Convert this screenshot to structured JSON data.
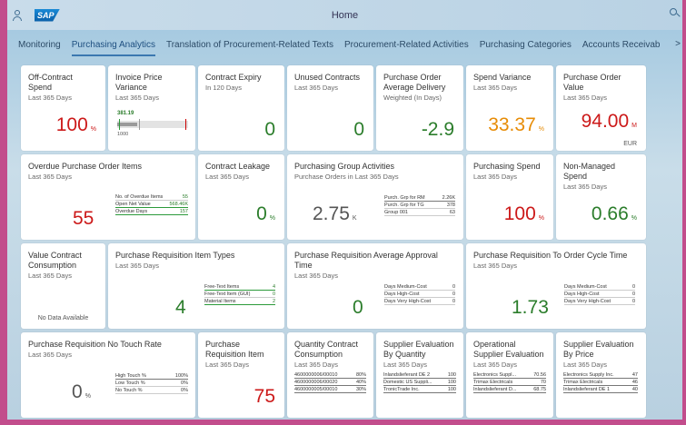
{
  "shell": {
    "title": "Home"
  },
  "tabs": [
    {
      "label": "Monitoring"
    },
    {
      "label": "Purchasing Analytics"
    },
    {
      "label": "Translation of Procurement-Related Texts"
    },
    {
      "label": "Procurement-Related Activities"
    },
    {
      "label": "Purchasing Categories"
    },
    {
      "label": "Accounts Receivab"
    }
  ],
  "tab_more": ">",
  "colors": {
    "negative": "#cc1919",
    "positive": "#2b7d2b",
    "critical": "#e78c07",
    "accent": "#3b78b0"
  },
  "tiles": {
    "offContract": {
      "title": "Off-Contract Spend",
      "sub": "Last 365 Days",
      "value": "100",
      "unit": "%"
    },
    "invoiceVariance": {
      "title": "Invoice Price Variance",
      "sub": "Last 365 Days",
      "value": "381.19",
      "min": "1000",
      "level": 0.28
    },
    "contractExpiry": {
      "title": "Contract Expiry",
      "sub": "In 120 Days",
      "value": "0"
    },
    "unusedContracts": {
      "title": "Unused Contracts",
      "sub": "Last 365 Days",
      "value": "0"
    },
    "poDelivery": {
      "title": "Purchase Order Average Delivery",
      "sub": "Weighted (In Days)",
      "value": "-2.9"
    },
    "spendVariance": {
      "title": "Spend Variance",
      "sub": "Last 365 Days",
      "value": "33.37",
      "unit": "%"
    },
    "poValue": {
      "title": "Purchase Order Value",
      "sub": "Last 365 Days",
      "value": "94.00",
      "unit": "M",
      "currency": "EUR"
    },
    "overduePO": {
      "title": "Overdue Purchase Order Items",
      "sub": "Last 365 Days",
      "value": "55",
      "rows": [
        {
          "label": "No. of Overdue Items",
          "value": "55"
        },
        {
          "label": "Open Net Value",
          "value": "568.46K"
        },
        {
          "label": "Overdue Days",
          "value": "157"
        }
      ]
    },
    "contractLeakage": {
      "title": "Contract Leakage",
      "sub": "Last 365 Days",
      "value": "0",
      "unit": "%"
    },
    "purchGroupActivities": {
      "title": "Purchasing Group Activities",
      "sub": "Purchase Orders in Last 365 Days",
      "value": "2.75",
      "unit": "K",
      "rows": [
        {
          "label": "Purch. Grp for RM",
          "value": "2.26K"
        },
        {
          "label": "Purch. Grp for TG",
          "value": "378"
        },
        {
          "label": "Group 001",
          "value": "63"
        }
      ]
    },
    "purchSpend": {
      "title": "Purchasing Spend",
      "sub": "Last 365 Days",
      "value": "100",
      "unit": "%"
    },
    "nonManaged": {
      "title": "Non-Managed Spend",
      "sub": "Last 365 Days",
      "value": "0.66",
      "unit": "%"
    },
    "valueContract": {
      "title": "Value Contract Consumption",
      "sub": "Last 365 Days",
      "nodata": "No Data Available"
    },
    "prItemTypes": {
      "title": "Purchase Requisition Item Types",
      "sub": "Last 365 Days",
      "value": "4",
      "rows": [
        {
          "label": "Free-Text Items",
          "value": "4"
        },
        {
          "label": "Free-Text Item (GUI)",
          "value": "0"
        },
        {
          "label": "Material Items",
          "value": "2"
        }
      ]
    },
    "prApproval": {
      "title": "Purchase Requisition Average Approval Time",
      "sub": "Last 365 Days",
      "value": "0",
      "rows": [
        {
          "label": "Days Medium-Cost",
          "value": "0"
        },
        {
          "label": "Days High-Cost",
          "value": "0"
        },
        {
          "label": "Days Very High-Cost",
          "value": "0"
        }
      ]
    },
    "prCycle": {
      "title": "Purchase Requisition To Order Cycle Time",
      "sub": "Last 365 Days",
      "value": "1.73",
      "rows": [
        {
          "label": "Days Medium-Cost",
          "value": "0"
        },
        {
          "label": "Days High-Cost",
          "value": "0"
        },
        {
          "label": "Days Very High-Cost",
          "value": "0"
        }
      ]
    },
    "prNoTouch": {
      "title": "Purchase Requisition No Touch Rate",
      "sub": "Last 365 Days",
      "value": "0",
      "unit": "%",
      "rows": [
        {
          "label": "High Touch %",
          "value": "100%"
        },
        {
          "label": "Low Touch %",
          "value": "0%"
        },
        {
          "label": "No Touch %",
          "value": "0%"
        }
      ]
    },
    "prItem": {
      "title": "Purchase Requisition Item",
      "sub": "Last 365 Days",
      "value": "75"
    },
    "qtyContract": {
      "title": "Quantity Contract Consumption",
      "sub": "Last 365 Days",
      "rows": [
        {
          "label": "4600000006/00010",
          "value": "80%"
        },
        {
          "label": "4600000006/00020",
          "value": "40%"
        },
        {
          "label": "4600000005/00010",
          "value": "30%"
        }
      ]
    },
    "supplierQty": {
      "title": "Supplier Evaluation By Quantity",
      "sub": "Last 365 Days",
      "rows": [
        {
          "label": "Inlandslieferant DE 2",
          "value": "100"
        },
        {
          "label": "Domestic US Suppli...",
          "value": "100"
        },
        {
          "label": "TronicTrade Inc.",
          "value": "100"
        }
      ]
    },
    "opSupplier": {
      "title": "Operational Supplier Evaluation",
      "sub": "Last 365 Days",
      "rows": [
        {
          "label": "Electronics Suppl...",
          "value": "70.56"
        },
        {
          "label": "Trimax Electricals",
          "value": "70"
        },
        {
          "label": "Inlandslieferant D...",
          "value": "68.75"
        }
      ]
    },
    "supplierPrice": {
      "title": "Supplier Evaluation By Price",
      "sub": "Last 365 Days",
      "rows": [
        {
          "label": "Electronics Supply Inc.",
          "value": "47"
        },
        {
          "label": "Trimax Electricals",
          "value": "46"
        },
        {
          "label": "Inlandslieferant DE 1",
          "value": "40"
        }
      ]
    }
  }
}
